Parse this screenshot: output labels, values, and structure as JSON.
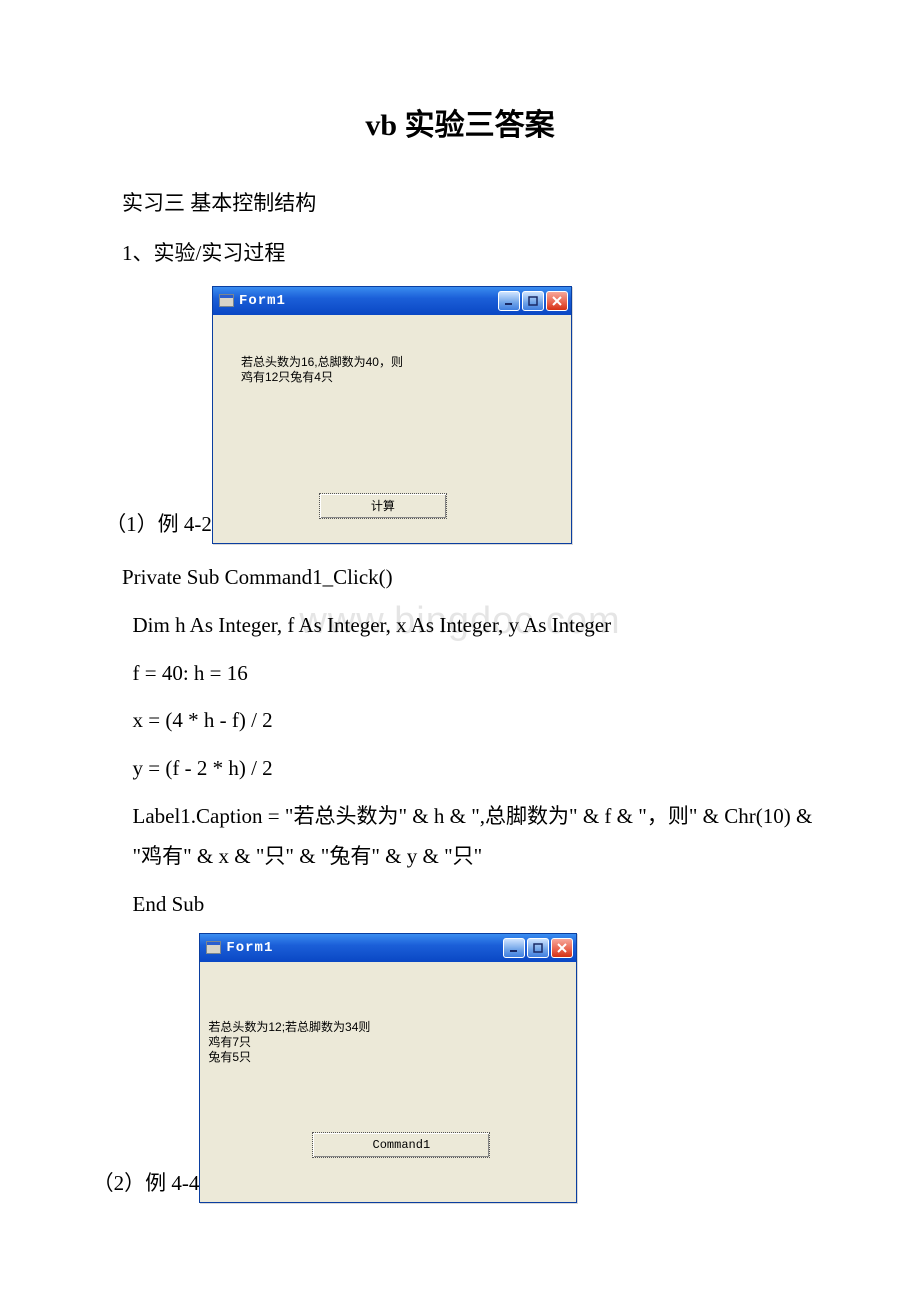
{
  "title": "vb 实验三答案",
  "heading_practice": "实习三 基本控制结构",
  "heading_process": "1、实验/实习过程",
  "example1_label": "（1）例 4-2",
  "example2_label": "（2）例 4-4",
  "watermark": "www.bingdoc.com",
  "form1": {
    "title": "Form1",
    "label_text": "若总头数为16,总脚数为40，则\n鸡有12只兔有4只",
    "button_text": "计算"
  },
  "form2": {
    "title": "Form1",
    "label_text": "若总头数为12;若总脚数为34则\n鸡有7只\n兔有5只",
    "button_text": "Command1"
  },
  "code1": {
    "l1": "Private Sub Command1_Click()",
    "l2": "Dim h As Integer, f As Integer, x As Integer, y As Integer",
    "l3": "f = 40: h = 16",
    "l4": "x = (4 * h - f) / 2",
    "l5": "y = (f - 2 * h) / 2",
    "l6": "Label1.Caption = \"若总头数为\" & h & \",总脚数为\" & f & \"，则\" & Chr(10) & \"鸡有\" & x & \"只\" & \"兔有\" & y & \"只\"",
    "l7": "End Sub"
  }
}
